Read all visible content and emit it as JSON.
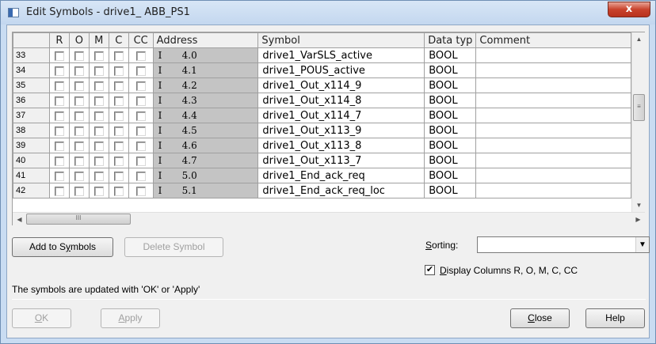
{
  "window": {
    "title": "Edit Symbols - drive1_ ABB_PS1",
    "close_glyph": "x"
  },
  "table": {
    "columns": [
      "",
      "R",
      "O",
      "M",
      "C",
      "CC",
      "Address",
      "Symbol",
      "Data typ",
      "Comment"
    ],
    "rows": [
      {
        "num": "33",
        "addr_type": "I",
        "addr": "4.0",
        "symbol": "drive1_VarSLS_active",
        "datatype": "BOOL",
        "comment": ""
      },
      {
        "num": "34",
        "addr_type": "I",
        "addr": "4.1",
        "symbol": "drive1_POUS_active",
        "datatype": "BOOL",
        "comment": ""
      },
      {
        "num": "35",
        "addr_type": "I",
        "addr": "4.2",
        "symbol": "drive1_Out_x114_9",
        "datatype": "BOOL",
        "comment": ""
      },
      {
        "num": "36",
        "addr_type": "I",
        "addr": "4.3",
        "symbol": "drive1_Out_x114_8",
        "datatype": "BOOL",
        "comment": ""
      },
      {
        "num": "37",
        "addr_type": "I",
        "addr": "4.4",
        "symbol": "drive1_Out_x114_7",
        "datatype": "BOOL",
        "comment": ""
      },
      {
        "num": "38",
        "addr_type": "I",
        "addr": "4.5",
        "symbol": "drive1_Out_x113_9",
        "datatype": "BOOL",
        "comment": ""
      },
      {
        "num": "39",
        "addr_type": "I",
        "addr": "4.6",
        "symbol": "drive1_Out_x113_8",
        "datatype": "BOOL",
        "comment": ""
      },
      {
        "num": "40",
        "addr_type": "I",
        "addr": "4.7",
        "symbol": "drive1_Out_x113_7",
        "datatype": "BOOL",
        "comment": ""
      },
      {
        "num": "41",
        "addr_type": "I",
        "addr": "5.0",
        "symbol": "drive1_End_ack_req",
        "datatype": "BOOL",
        "comment": ""
      },
      {
        "num": "42",
        "addr_type": "I",
        "addr": "5.1",
        "symbol": "drive1_End_ack_req_loc",
        "datatype": "BOOL",
        "comment": ""
      }
    ]
  },
  "buttons": {
    "add_to_symbols": {
      "pre": "Add to S",
      "u": "y",
      "post": "mbols"
    },
    "delete_symbol": "Delete Symbol",
    "ok": {
      "u": "O",
      "post": "K"
    },
    "apply": {
      "u": "A",
      "post": "pply"
    },
    "close": {
      "u": "C",
      "post": "lose"
    },
    "help": "Help"
  },
  "sorting": {
    "u": "S",
    "post": "orting:",
    "value": ""
  },
  "display_columns": {
    "checked": true,
    "u": "D",
    "post": "isplay Columns R, O, M, C, CC",
    "check_glyph": "✔"
  },
  "info_text": "The symbols are updated with 'OK' or  'Apply'",
  "icons": {
    "scroll_up": "▲",
    "scroll_down": "▼",
    "scroll_left": "◀",
    "scroll_right": "▶",
    "hthumb_grip": "III",
    "vthumb_grip": "≡",
    "dropdown": "▼"
  }
}
